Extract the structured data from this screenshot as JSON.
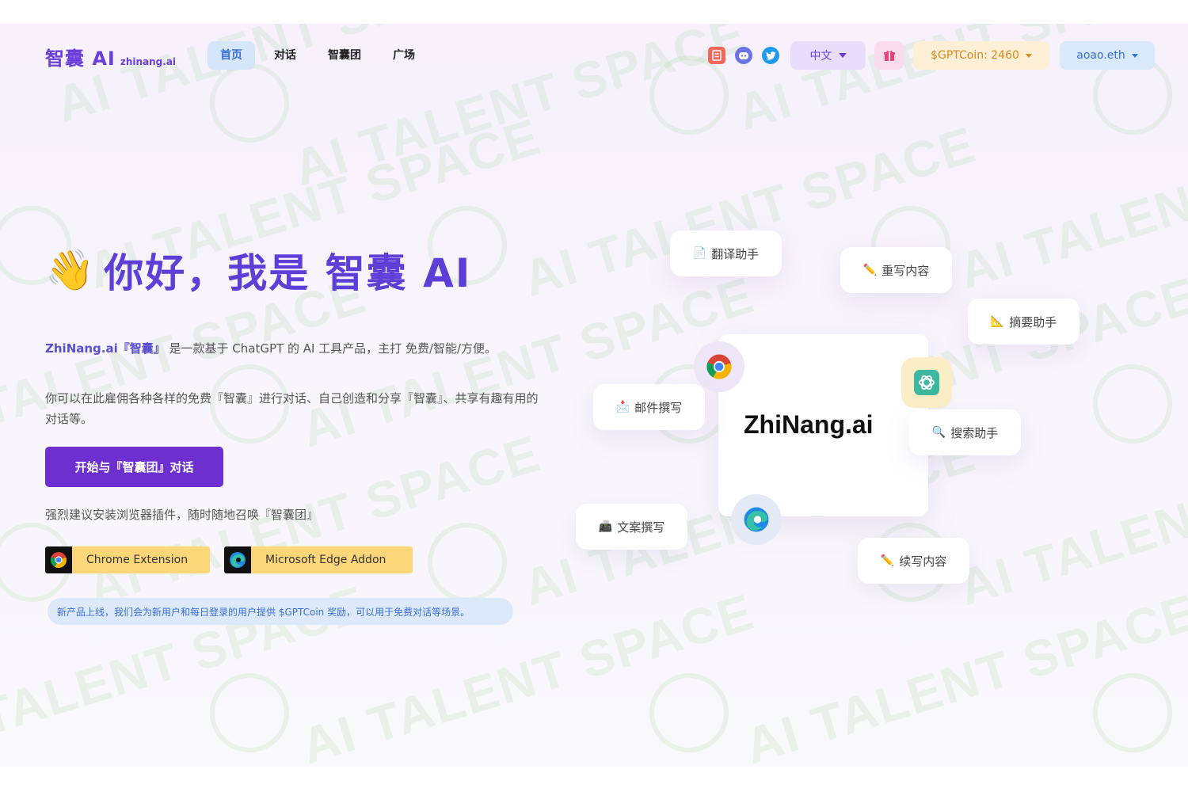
{
  "header": {
    "logo_main": "智囊 AI",
    "logo_sub": "zhinang.ai",
    "nav": [
      {
        "label": "首页",
        "active": true
      },
      {
        "label": "对话",
        "active": false
      },
      {
        "label": "智囊团",
        "active": false
      },
      {
        "label": "广场",
        "active": false
      }
    ],
    "language": "中文",
    "coin": "$GPTCoin: 2460",
    "account": "aoao.eth"
  },
  "hero": {
    "wave_icon": "👋",
    "title": "你好，我是 智囊 AI",
    "desc1_brand": "ZhiNang.ai『智囊』",
    "desc1_rest": " 是一款基于 ChatGPT 的 AI 工具产品，主打 免费/智能/方便。",
    "desc2": "你可以在此雇佣各种各样的免费『智囊』进行对话、自己创造和分享『智囊』、共享有趣有用的对话等。",
    "cta": "开始与『智囊团』对话",
    "plugin_tip": "强烈建议安装浏览器插件，随时随地召唤『智囊团』",
    "chrome_label": "Chrome Extension",
    "edge_label": "Microsoft Edge Addon",
    "notice": "新产品上线，我们会为新用户和每日登录的用户提供 $GPTCoin 奖励，可以用于免费对话等场景。"
  },
  "cloud": {
    "brand": "ZhiNang.ai",
    "cards": [
      {
        "label": "翻译助手",
        "icon": "📄"
      },
      {
        "label": "重写内容",
        "icon": "✏️"
      },
      {
        "label": "摘要助手",
        "icon": "📐"
      },
      {
        "label": "邮件撰写",
        "icon": "📩"
      },
      {
        "label": "搜索助手",
        "icon": "🔍"
      },
      {
        "label": "文案撰写",
        "icon": "📠"
      },
      {
        "label": "续写内容",
        "icon": "✏️"
      }
    ]
  },
  "watermark": "AI TALENT SPACE",
  "colors": {
    "brand_purple": "#6d2fd0",
    "nav_active_bg": "#d5e6f8",
    "coin_bg": "#fdefd6",
    "account_bg": "#d9e9fa",
    "lang_bg": "#e9defa",
    "extension_yellow": "#fbd77a"
  }
}
